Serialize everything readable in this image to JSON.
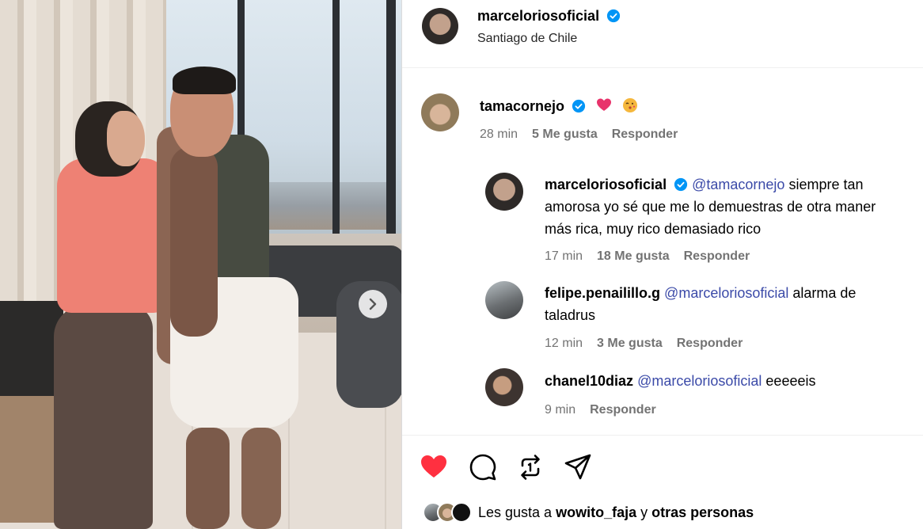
{
  "post": {
    "author": "marceloriosoficial",
    "location": "Santiago de Chile"
  },
  "comments": [
    {
      "user": "tamacornejo",
      "text": "",
      "emojis": [
        "heart",
        "kiss-face"
      ],
      "time": "28 min",
      "likes": "5 Me gusta",
      "reply": "Responder"
    }
  ],
  "replies": [
    {
      "user": "marceloriosoficial",
      "mention": "@tamacornejo",
      "text_line1": "siempre tan",
      "text_line2": "amorosa yo sé que me lo demuestras de otra maner",
      "text_line3": "más rica, muy rico demasiado rico",
      "time": "17 min",
      "likes": "18 Me gusta",
      "reply": "Responder"
    },
    {
      "user": "felipe.penailillo.g",
      "mention": "@marceloriosoficial",
      "text_line1": "alarma de",
      "text_line2": "taladrus",
      "time": "12 min",
      "likes": "3 Me gusta",
      "reply": "Responder"
    },
    {
      "user": "chanel10diaz",
      "mention": "@marceloriosoficial",
      "text_line1": "eeeeeis",
      "time": "9 min",
      "reply": "Responder"
    }
  ],
  "likes_summary": {
    "prefix": "Les gusta a",
    "user": "wowito_faja",
    "connector": "y",
    "suffix": "otras personas"
  },
  "icons": {
    "like": "heart-icon",
    "comment": "comment-icon",
    "repost": "repost-icon",
    "share": "share-icon",
    "next": "chevron-right-icon",
    "verified": "verified-badge-icon"
  },
  "colors": {
    "like_red": "#ff3040",
    "verified_blue": "#0095f6",
    "mention": "#3b4aa8",
    "meta_gray": "#737373"
  }
}
